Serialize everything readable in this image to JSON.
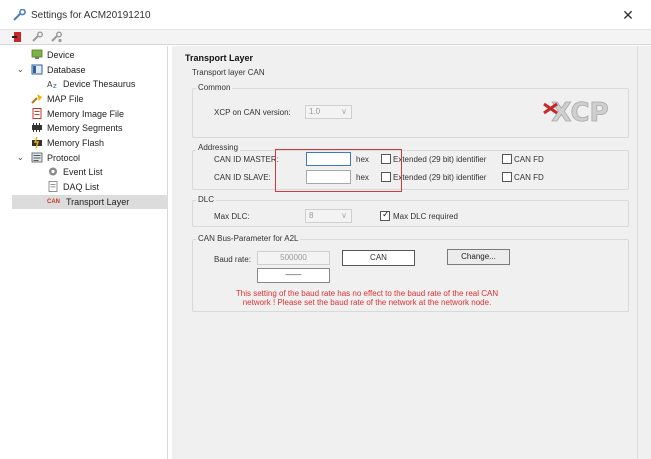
{
  "window": {
    "title": "Settings for ACM20191210",
    "close_glyph": "✕"
  },
  "toolbar": {
    "icons": [
      "exit-icon",
      "wrench-icon",
      "wrench-settings-icon"
    ]
  },
  "tree": {
    "device": "Device",
    "database": "Database",
    "device_thesaurus": "Device Thesaurus",
    "map_file": "MAP File",
    "memory_image_file": "Memory Image File",
    "memory_segments": "Memory Segments",
    "memory_flash": "Memory Flash",
    "protocol": "Protocol",
    "event_list": "Event List",
    "daq_list": "DAQ List",
    "transport_layer_badge": "CAN",
    "transport_layer": "Transport Layer",
    "expand_glyph": "⌄"
  },
  "page": {
    "heading": "Transport Layer",
    "subheading": "Transport layer CAN"
  },
  "common": {
    "title": "Common",
    "xcp_version_label": "XCP on CAN version:",
    "xcp_version_value": "1.0",
    "dropdown_arrow": "∨",
    "logo_text": "XCP"
  },
  "addressing": {
    "title": "Addressing",
    "master_label": "CAN ID MASTER:",
    "master_value": "",
    "slave_label": "CAN ID SLAVE:",
    "slave_value": "",
    "hex_label": "hex",
    "extended_label": "Extended (29 bit) identifier",
    "canfd_label": "CAN FD"
  },
  "dlc": {
    "title": "DLC",
    "max_dlc_label": "Max DLC:",
    "max_dlc_value": "8",
    "max_dlc_required_label": "Max DLC required",
    "max_dlc_required_checked": true
  },
  "bus": {
    "title": "CAN Bus-Parameter for A2L",
    "baud_label": "Baud rate:",
    "baud_value": "500000",
    "bus_type_value": "CAN",
    "change_button": "Change...",
    "secondary_value": "——",
    "warning_line1": "This setting of the baud rate has no effect to the baud rate of the real CAN",
    "warning_line2": "network ! Please set the baud rate of the network at the network node."
  },
  "colors": {
    "accent_blue": "#3a78c9",
    "warning_red": "#e03030",
    "highlight_red": "#d23b3b"
  }
}
